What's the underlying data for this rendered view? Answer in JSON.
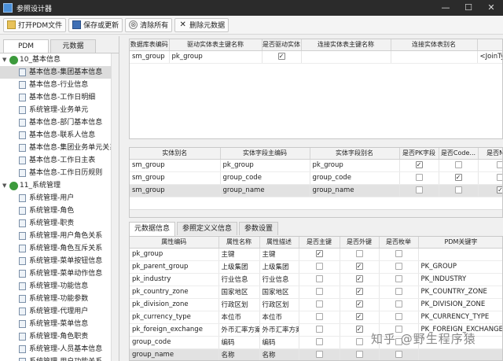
{
  "window": {
    "title": "参照设计器",
    "min": "—",
    "max": "☐",
    "close": "✕"
  },
  "toolbar": {
    "open": "打开PDM文件",
    "save": "保存或更新",
    "clear": "清除所有",
    "delete": "删除元数据"
  },
  "left_tabs": [
    "PDM",
    "元数据"
  ],
  "tree": [
    {
      "type": "group",
      "label": "10_基本信息"
    },
    {
      "type": "leaf",
      "label": "基本信息-集团基本信息",
      "selected": true
    },
    {
      "type": "leaf",
      "label": "基本信息-行业信息"
    },
    {
      "type": "leaf",
      "label": "基本信息-工作日明细"
    },
    {
      "type": "leaf",
      "label": "系统管理-业务单元"
    },
    {
      "type": "leaf",
      "label": "基本信息-部门基本信息"
    },
    {
      "type": "leaf",
      "label": "基本信息-联系人信息"
    },
    {
      "type": "leaf",
      "label": "基本信息-集团业务单元关系"
    },
    {
      "type": "leaf",
      "label": "基本信息-工作日主表"
    },
    {
      "type": "leaf",
      "label": "基本信息-工作日历规则"
    },
    {
      "type": "group",
      "label": "11_系统管理"
    },
    {
      "type": "leaf",
      "label": "系统管理-用户"
    },
    {
      "type": "leaf",
      "label": "系统管理-角色"
    },
    {
      "type": "leaf",
      "label": "系统管理-职责"
    },
    {
      "type": "leaf",
      "label": "系统管理-用户角色关系"
    },
    {
      "type": "leaf",
      "label": "系统管理-角色互斥关系"
    },
    {
      "type": "leaf",
      "label": "系统管理-菜单按钮信息"
    },
    {
      "type": "leaf",
      "label": "系统管理-菜单动作信息"
    },
    {
      "type": "leaf",
      "label": "系统管理-功能信息"
    },
    {
      "type": "leaf",
      "label": "系统管理-功能参数"
    },
    {
      "type": "leaf",
      "label": "系统管理-代理用户"
    },
    {
      "type": "leaf",
      "label": "系统管理-菜单信息"
    },
    {
      "type": "leaf",
      "label": "系统管理-角色职责"
    },
    {
      "type": "leaf",
      "label": "系统管理-人员基本信息"
    },
    {
      "type": "leaf",
      "label": "系统管理-用户功能关系"
    }
  ],
  "table1": {
    "headers": [
      "数据库表编码",
      "驱动实体表主键名称",
      "是否驱动实体",
      "连接实体表主键名称",
      "连接实体表别名",
      "连"
    ],
    "rows": [
      {
        "code": "sm_group",
        "pk": "pk_group",
        "drive": true,
        "jpk": "",
        "alias": "",
        "join": "<JoinTyp"
      }
    ]
  },
  "table2": {
    "headers": [
      "实体别名",
      "实体字段主编码",
      "实体字段别名",
      "是否PK字段",
      "是否Code...",
      "是否Nam"
    ],
    "rows": [
      {
        "alias": "sm_group",
        "code": "pk_group",
        "falias": "pk_group",
        "pk": true,
        "iscode": false,
        "isname": false
      },
      {
        "alias": "sm_group",
        "code": "group_code",
        "falias": "group_code",
        "pk": false,
        "iscode": true,
        "isname": false
      },
      {
        "alias": "sm_group",
        "code": "group_name",
        "falias": "group_name",
        "pk": false,
        "iscode": false,
        "isname": true,
        "selected": true
      }
    ]
  },
  "bottom_tabs": [
    "元数据信息",
    "参照定义义信息",
    "参数设置"
  ],
  "table3": {
    "headers": [
      "属性编码",
      "属性名称",
      "属性描述",
      "是否主键",
      "是否外键",
      "是否枚举",
      "PDM关键字"
    ],
    "rows": [
      {
        "code": "pk_group",
        "name": "主键",
        "desc": "主键",
        "pk": true,
        "fk": false,
        "enum": false,
        "kw": ""
      },
      {
        "code": "pk_parent_group",
        "name": "上级集团",
        "desc": "上级集团",
        "pk": false,
        "fk": true,
        "enum": false,
        "kw": "PK_GROUP"
      },
      {
        "code": "pk_industry",
        "name": "行业信息",
        "desc": "行业信息",
        "pk": false,
        "fk": true,
        "enum": false,
        "kw": "PK_INDUSTRY"
      },
      {
        "code": "pk_country_zone",
        "name": "国家地区",
        "desc": "国家地区",
        "pk": false,
        "fk": true,
        "enum": false,
        "kw": "PK_COUNTRY_ZONE"
      },
      {
        "code": "pk_division_zone",
        "name": "行政区划",
        "desc": "行政区划",
        "pk": false,
        "fk": true,
        "enum": false,
        "kw": "PK_DIVISION_ZONE"
      },
      {
        "code": "pk_currency_type",
        "name": "本位币",
        "desc": "本位币",
        "pk": false,
        "fk": true,
        "enum": false,
        "kw": "PK_CURRENCY_TYPE"
      },
      {
        "code": "pk_foreign_exchange",
        "name": "外币汇率方案",
        "desc": "外币汇率方案",
        "pk": false,
        "fk": true,
        "enum": false,
        "kw": "PK_FOREIGN_EXCHANGE"
      },
      {
        "code": "group_code",
        "name": "编码",
        "desc": "编码",
        "pk": false,
        "fk": false,
        "enum": false,
        "kw": ""
      },
      {
        "code": "group_name",
        "name": "名称",
        "desc": "名称",
        "pk": false,
        "fk": false,
        "enum": false,
        "kw": "",
        "selected": true
      }
    ]
  },
  "watermark": "知乎 @野生程序猿"
}
